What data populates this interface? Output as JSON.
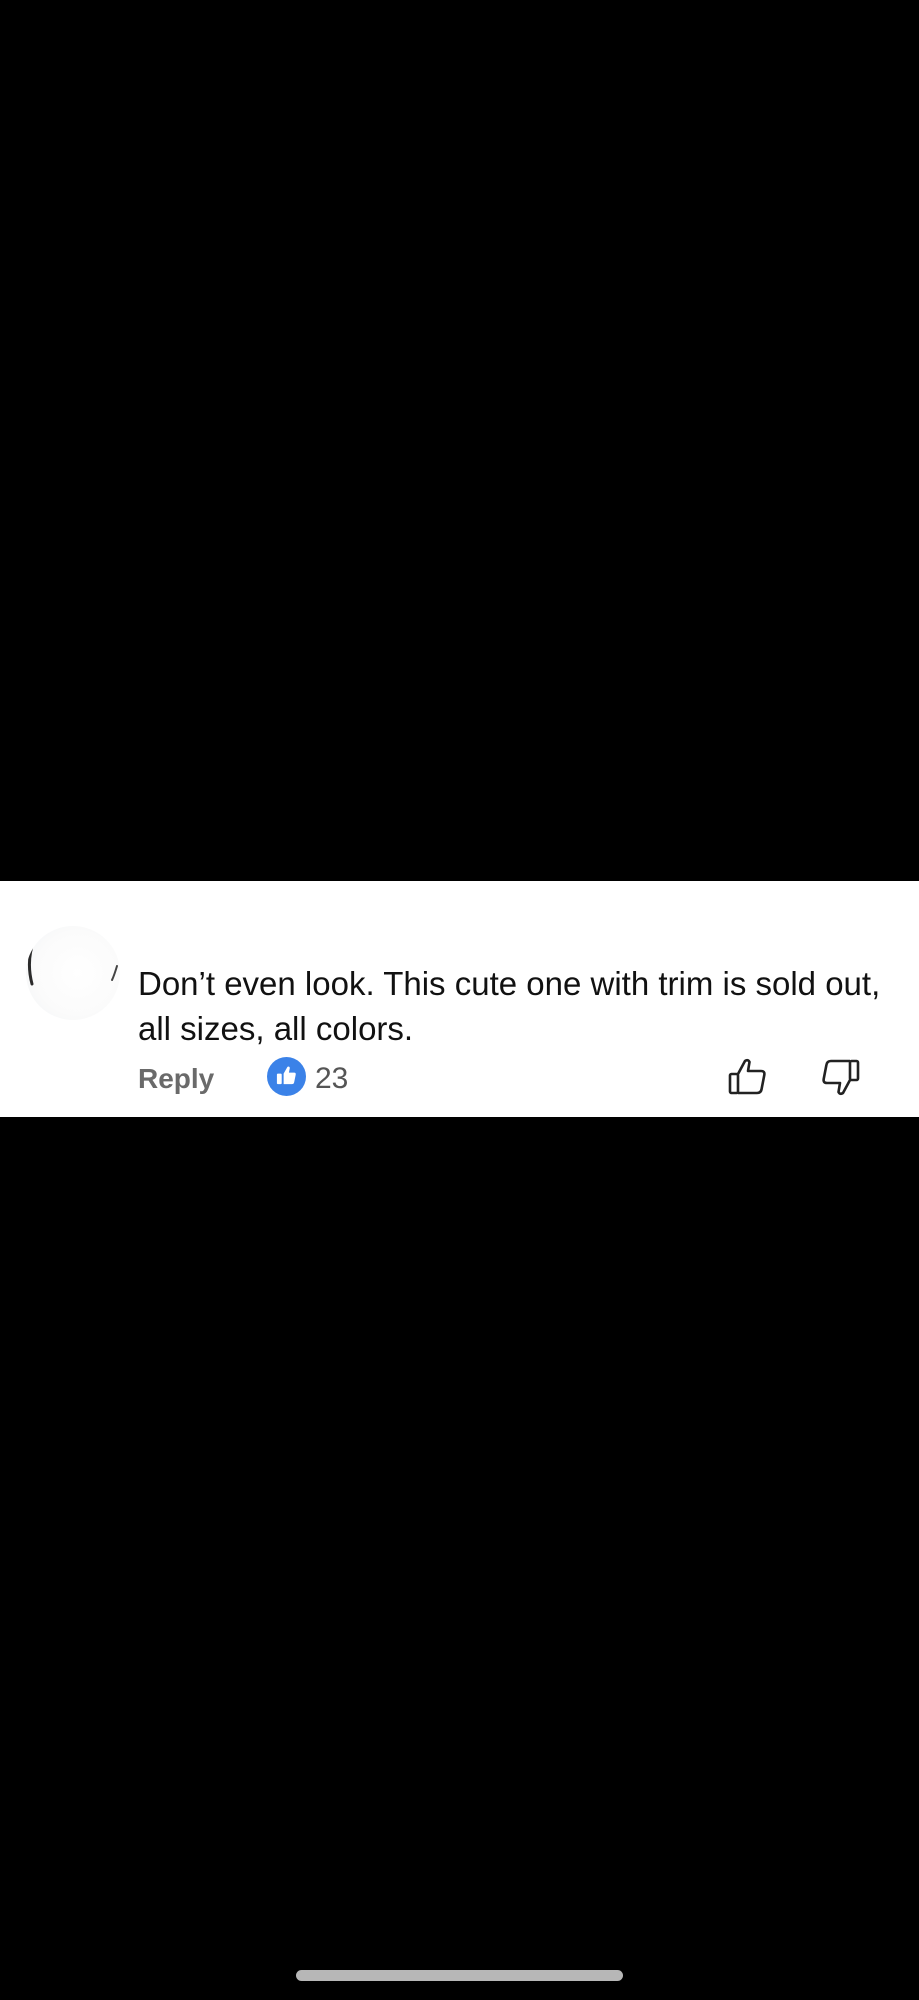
{
  "comment": {
    "author": "",
    "text": "Don’t even look. This cute one with trim is sold out, all sizes, all colors.",
    "reply_label": "Reply",
    "like_count": "23",
    "like_badge_icon": "thumbs-up-icon",
    "upvote_icon": "thumbs-up-outline-icon",
    "downvote_icon": "thumbs-down-outline-icon"
  },
  "colors": {
    "background": "#000000",
    "card": "#ffffff",
    "like_badge": "#3b82e8",
    "text": "#111111",
    "muted_text": "#6a6a6a",
    "home_indicator": "#b7b7b7"
  }
}
